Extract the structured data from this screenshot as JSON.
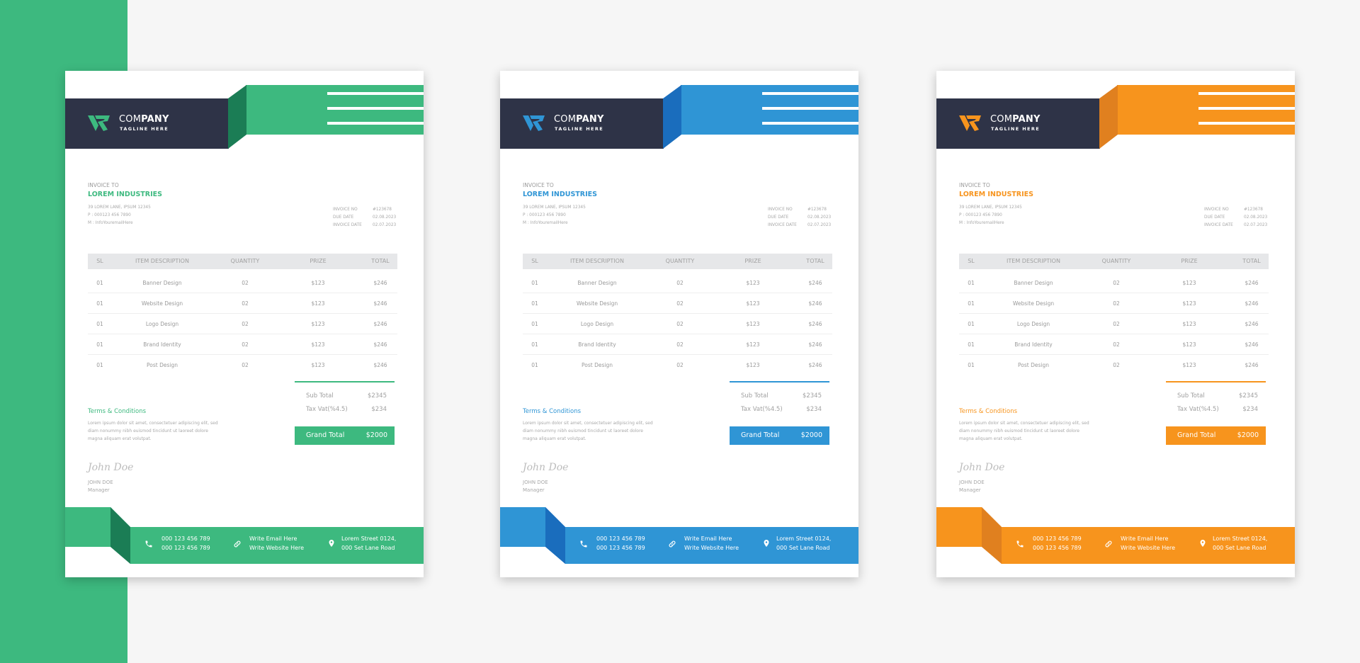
{
  "background_accent": "#3db97f",
  "invoice": {
    "company_light": "COM",
    "company_bold": "PANY",
    "tagline": "TAGLINE HERE",
    "invoice_to_label": "INVOICE TO",
    "client_name": "LOREM INDUSTRIES",
    "client_address": "39 LOREM LANE, IPSUM 12345",
    "client_phone": "P : 000123 456 7890",
    "client_email": "M : InfoYouremailHere",
    "meta": [
      {
        "label": "INVOICE NO",
        "value": "#123678"
      },
      {
        "label": "DUE DATE",
        "value": "02.08.2023"
      },
      {
        "label": "INVOICE DATE",
        "value": "02.07.2023"
      }
    ],
    "table_headers": [
      "SL",
      "ITEM DESCRIPTION",
      "QUANTITY",
      "PRIZE",
      "TOTAL"
    ],
    "rows": [
      [
        "01",
        "Banner Design",
        "02",
        "$123",
        "$246"
      ],
      [
        "01",
        "Website Design",
        "02",
        "$123",
        "$246"
      ],
      [
        "01",
        "Logo Design",
        "02",
        "$123",
        "$246"
      ],
      [
        "01",
        "Brand Identity",
        "02",
        "$123",
        "$246"
      ],
      [
        "01",
        "Post Design",
        "02",
        "$123",
        "$246"
      ]
    ],
    "sub_total_label": "Sub Total",
    "sub_total_value": "$2345",
    "tax_label": "Tax Vat(%4.5)",
    "tax_value": "$234",
    "grand_total_label": "Grand Total",
    "grand_total_value": "$2000",
    "terms_title": "Terms & Conditions",
    "terms_text": "Lorem ipsum dolor sit amet, consectetuer adipiscing elit, sed diam nonummy nibh euismod tincidunt ut laoreet dolore magna aliquam erat volutpat.",
    "signature": "John Doe",
    "signer_name": "JOHN DOE",
    "signer_title": "Manager",
    "footer": {
      "phone_lines": [
        "000 123 456 789",
        "000 123 456 789"
      ],
      "web_lines": [
        "Write Email Here",
        "Write Website Here"
      ],
      "address_lines": [
        "Lorem Street 0124,",
        "000 Set Lane Road"
      ],
      "icons": [
        "phone-icon",
        "link-icon",
        "location-pin-icon"
      ]
    }
  },
  "pages": [
    {
      "theme": "green",
      "accent": "#3db97f",
      "accent_dark": "#1b7d55"
    },
    {
      "theme": "blue",
      "accent": "#2f95d5",
      "accent_dark": "#1a6dbd"
    },
    {
      "theme": "orange",
      "accent": "#f7941d",
      "accent_dark": "#e0801f"
    }
  ]
}
